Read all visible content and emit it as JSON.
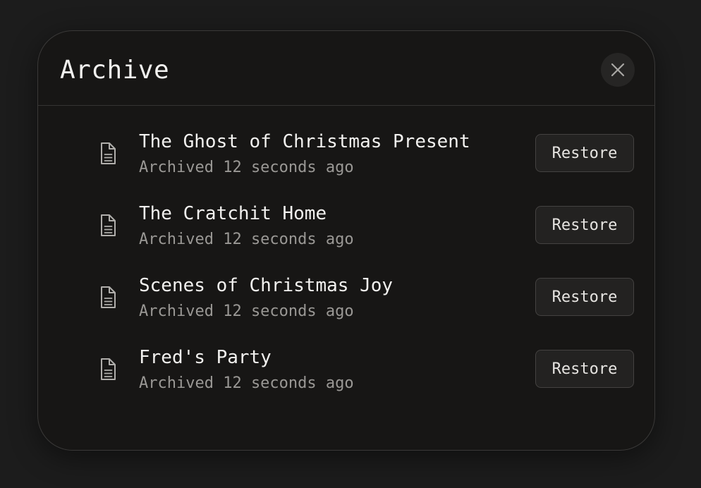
{
  "dialog": {
    "title": "Archive",
    "close_icon": "close-icon"
  },
  "items": [
    {
      "title": "The Ghost of Christmas Present",
      "meta": "Archived 12 seconds ago",
      "action": "Restore",
      "icon": "document-icon"
    },
    {
      "title": "The Cratchit Home",
      "meta": "Archived 12 seconds ago",
      "action": "Restore",
      "icon": "document-icon"
    },
    {
      "title": "Scenes of Christmas Joy",
      "meta": "Archived 12 seconds ago",
      "action": "Restore",
      "icon": "document-icon"
    },
    {
      "title": "Fred's Party",
      "meta": "Archived 12 seconds ago",
      "action": "Restore",
      "icon": "document-icon"
    }
  ],
  "colors": {
    "background": "#1c1c1c",
    "panel": "#171615",
    "text_primary": "#f2f1ef",
    "text_secondary": "#9a9895",
    "button_bg": "#232221",
    "border": "#3a3938"
  }
}
